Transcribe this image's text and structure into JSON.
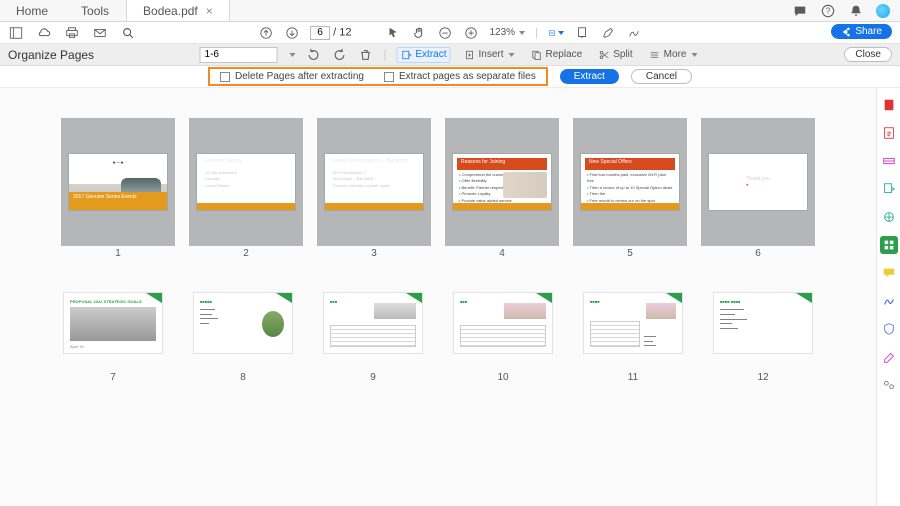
{
  "tabs": {
    "home": "Home",
    "tools": "Tools",
    "doc": "Bodea.pdf"
  },
  "page": {
    "current": "6",
    "sep": "/",
    "total": "12"
  },
  "zoom": {
    "value": "123%"
  },
  "share": "Share",
  "orgbar": {
    "title": "Organize Pages",
    "range": "1-6",
    "extract": "Extract",
    "insert": "Insert",
    "replace": "Replace",
    "split": "Split",
    "more": "More",
    "close": "Close"
  },
  "extractbar": {
    "deleteAfter": "Delete Pages after extracting",
    "separate": "Extract pages as separate files",
    "extract": "Extract",
    "cancel": "Cancel"
  },
  "side_icons": [
    "pdf",
    "create",
    "edit",
    "export",
    "share",
    "organize",
    "comment",
    "sign",
    "protect",
    "fill",
    "more-tools"
  ],
  "thumbs_row1": [
    {
      "n": "1",
      "bandTitle": "2017 Genuine Series Events"
    },
    {
      "n": "2",
      "hdr": "Customer Survey",
      "line1": "12,345 customers",
      "line2": "Canada",
      "line3": "United States"
    },
    {
      "n": "3",
      "hdr": "Survey Demographics – Highlights",
      "line1": "80% Generation Y",
      "line2": "Mid Range – $30-$50k",
      "line3": "Diverse collection of work styles"
    },
    {
      "n": "4",
      "hdr": "Reasons for Joining",
      "l1": "Comprehend the customer",
      "l2": "Offer flexibility",
      "l3": "Benefit: Partner respect Experience",
      "l4": "Promote Loyalty",
      "l5": "Provide value added service"
    },
    {
      "n": "5",
      "hdr": "New Special Offers",
      "b1": "First four months paid, exclusive Wi-Fi plan free",
      "b2": "Then a choice of up to 10 Special Option deals",
      "b3": "Then the",
      "b4": "Free month to review our on the spot"
    },
    {
      "n": "6",
      "ty": "Thank you"
    }
  ],
  "thumbs_row2": [
    {
      "n": "7"
    },
    {
      "n": "8"
    },
    {
      "n": "9"
    },
    {
      "n": "10"
    },
    {
      "n": "11"
    },
    {
      "n": "12"
    }
  ]
}
